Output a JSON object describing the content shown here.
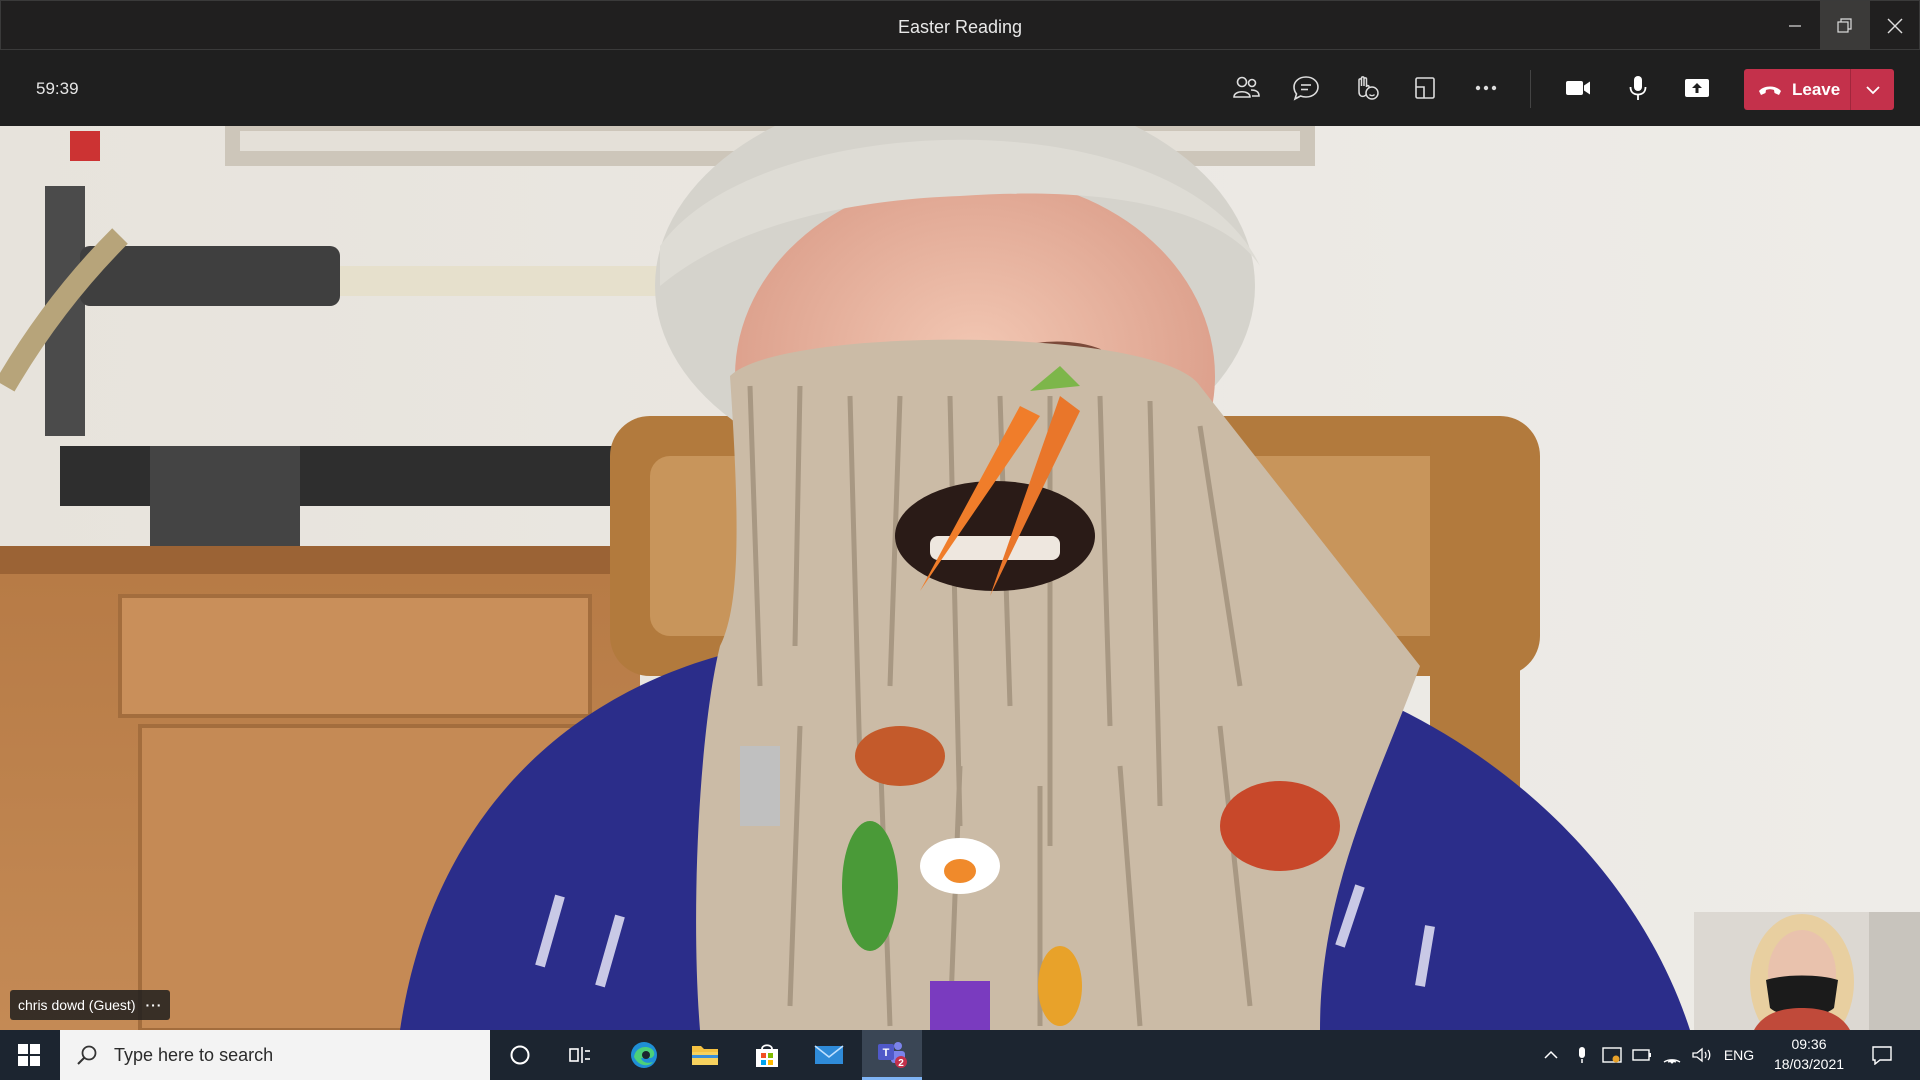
{
  "window": {
    "title": "Easter Reading"
  },
  "toolbar": {
    "timer": "59:39",
    "buttons": [
      {
        "name": "participants-icon"
      },
      {
        "name": "chat-icon"
      },
      {
        "name": "reactions-icon"
      },
      {
        "name": "rooms-icon"
      },
      {
        "name": "more-actions-icon"
      },
      {
        "name": "camera-icon"
      },
      {
        "name": "microphone-icon"
      },
      {
        "name": "share-icon"
      }
    ],
    "leave_label": "Leave",
    "leave_color": "#c4314b"
  },
  "stage": {
    "participant_name": "chris dowd (Guest)",
    "name_more": "···"
  },
  "taskbar": {
    "search_placeholder": "Type here to search",
    "teams_badge": "2",
    "language": "ENG",
    "time": "09:36",
    "date": "18/03/2021"
  }
}
